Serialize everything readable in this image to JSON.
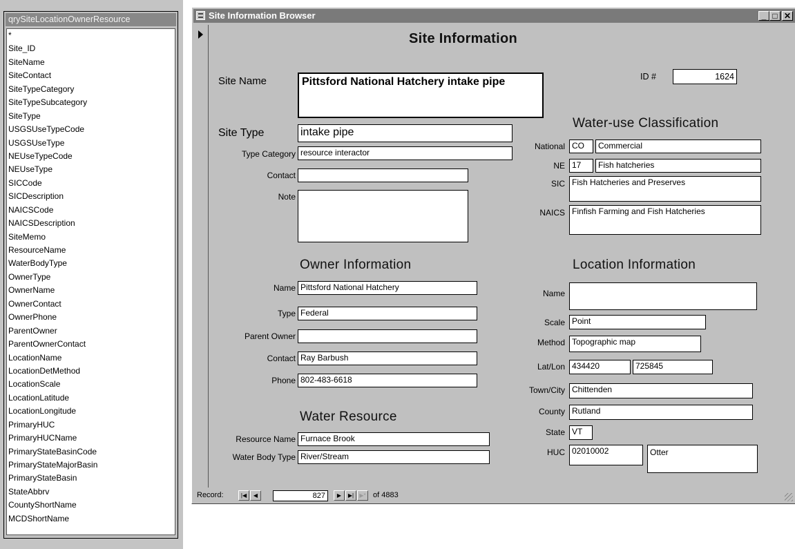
{
  "field_list": {
    "title": "qrySiteLocationOwnerResource",
    "items": [
      "*",
      "Site_ID",
      "SiteName",
      "SiteContact",
      "SiteTypeCategory",
      "SiteTypeSubcategory",
      "SiteType",
      "USGSUseTypeCode",
      "USGSUseType",
      "NEUseTypeCode",
      "NEUseType",
      "SICCode",
      "SICDescription",
      "NAICSCode",
      "NAICSDescription",
      "SiteMemo",
      "ResourceName",
      "WaterBodyType",
      "OwnerType",
      "OwnerName",
      "OwnerContact",
      "OwnerPhone",
      "ParentOwner",
      "ParentOwnerContact",
      "LocationName",
      "LocationDetMethod",
      "LocationScale",
      "LocationLatitude",
      "LocationLongitude",
      "PrimaryHUC",
      "PrimaryHUCName",
      "PrimaryStateBasinCode",
      "PrimaryStateMajorBasin",
      "PrimaryStateBasin",
      "StateAbbrv",
      "CountyShortName",
      "MCDShortName"
    ]
  },
  "window": {
    "title": "Site Information Browser",
    "buttons": {
      "minimize": "_",
      "maximize": "□",
      "close": "✕"
    }
  },
  "form": {
    "heading": "Site Information",
    "site_name": {
      "label": "Site Name",
      "value": "Pittsford National Hatchery intake pipe"
    },
    "id": {
      "label": "ID #",
      "value": "1624"
    },
    "site_type": {
      "label": "Site Type",
      "value": "intake pipe"
    },
    "type_category": {
      "label": "Type Category",
      "value": "resource interactor"
    },
    "contact": {
      "label": "Contact",
      "value": ""
    },
    "note": {
      "label": "Note",
      "value": ""
    },
    "water_use": {
      "heading": "Water-use Classification",
      "national": {
        "label": "National",
        "code": "CO",
        "value": "Commercial"
      },
      "ne": {
        "label": "NE",
        "code": "17",
        "value": "Fish hatcheries"
      },
      "sic": {
        "label": "SIC",
        "value": "Fish Hatcheries and Preserves"
      },
      "naics": {
        "label": "NAICS",
        "value": "Finfish Farming and Fish Hatcheries"
      }
    },
    "owner": {
      "heading": "Owner Information",
      "name": {
        "label": "Name",
        "value": "Pittsford National Hatchery"
      },
      "type": {
        "label": "Type",
        "value": "Federal"
      },
      "parent_owner": {
        "label": "Parent Owner",
        "value": ""
      },
      "contact": {
        "label": "Contact",
        "value": "Ray Barbush"
      },
      "phone": {
        "label": "Phone",
        "value": "802-483-6618"
      }
    },
    "water_resource": {
      "heading": "Water Resource",
      "resource_name": {
        "label": "Resource Name",
        "value": "Furnace Brook"
      },
      "water_body_type": {
        "label": "Water Body Type",
        "value": "River/Stream"
      }
    },
    "location": {
      "heading": "Location Information",
      "name": {
        "label": "Name",
        "value": ""
      },
      "scale": {
        "label": "Scale",
        "value": "Point"
      },
      "method": {
        "label": "Method",
        "value": "Topographic map"
      },
      "latlon": {
        "label": "Lat/Lon",
        "lat": "434420",
        "lon": "725845"
      },
      "town": {
        "label": "Town/City",
        "value": "Chittenden"
      },
      "county": {
        "label": "County",
        "value": "Rutland"
      },
      "state": {
        "label": "State",
        "value": "VT"
      },
      "huc": {
        "label": "HUC",
        "code": "02010002",
        "name": "Otter"
      }
    }
  },
  "navigation": {
    "label": "Record:",
    "current": "827",
    "of_text": "of  4883",
    "buttons": {
      "first": "|◀",
      "prev": "◀",
      "next": "▶",
      "last": "▶|",
      "new": "▶*"
    }
  }
}
